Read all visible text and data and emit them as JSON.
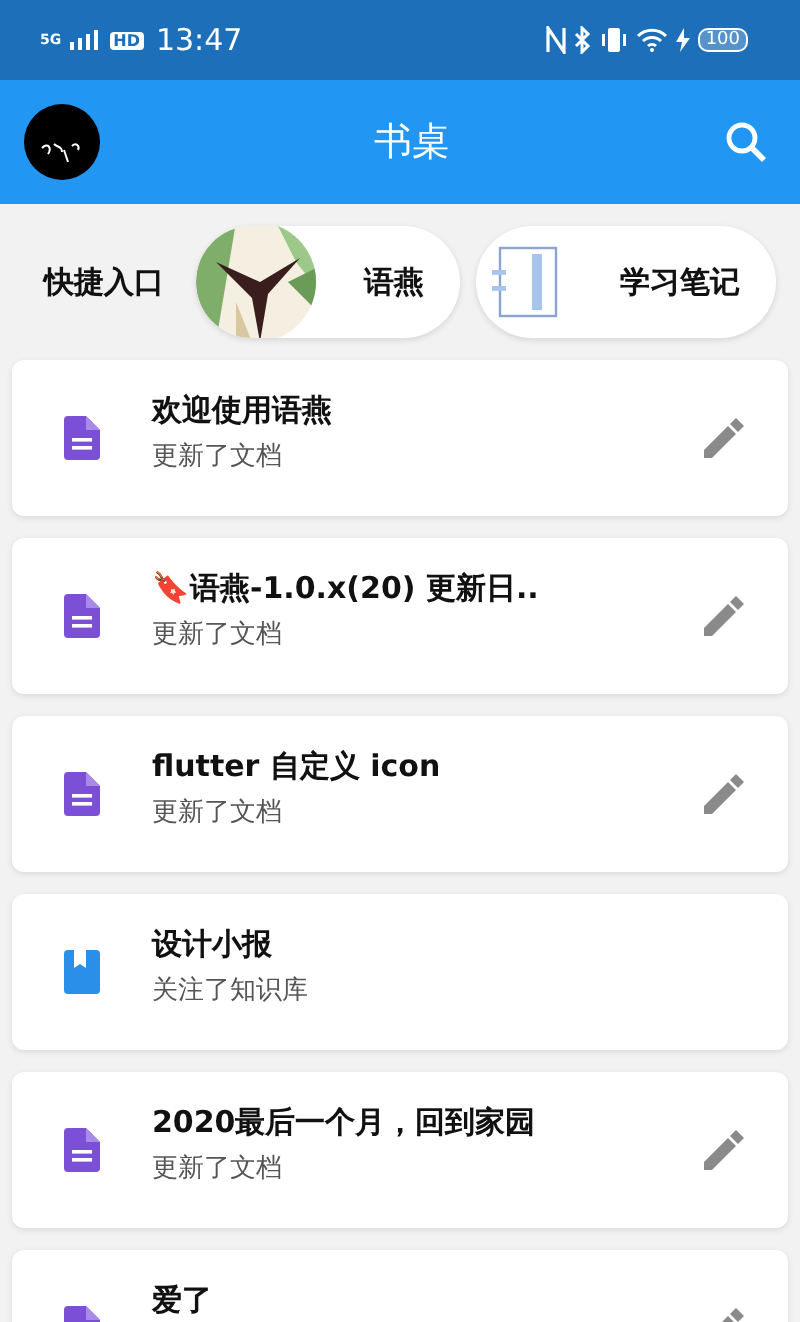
{
  "status_bar": {
    "network": "5G",
    "hd": "HD",
    "time": "13:47",
    "battery": "100"
  },
  "app_bar": {
    "title": "书桌"
  },
  "quick_entry": {
    "label": "快捷入口",
    "items": [
      {
        "kind": "picture",
        "label": "语燕"
      },
      {
        "kind": "notebook",
        "label": "学习笔记"
      }
    ]
  },
  "documents": [
    {
      "kind": "doc",
      "title": "欢迎使用语燕",
      "subtitle": "更新了文档",
      "editable": true
    },
    {
      "kind": "doc",
      "title": "🔖语燕-1.0.x(20) 更新日..",
      "subtitle": "更新了文档",
      "editable": true
    },
    {
      "kind": "doc",
      "title": "flutter 自定义 icon",
      "subtitle": "更新了文档",
      "editable": true
    },
    {
      "kind": "book",
      "title": "设计小报",
      "subtitle": "关注了知识库",
      "editable": false
    },
    {
      "kind": "doc",
      "title": "2020最后一个月，回到家园",
      "subtitle": "更新了文档",
      "editable": true
    },
    {
      "kind": "doc",
      "title": "爱了",
      "editable": true
    }
  ]
}
